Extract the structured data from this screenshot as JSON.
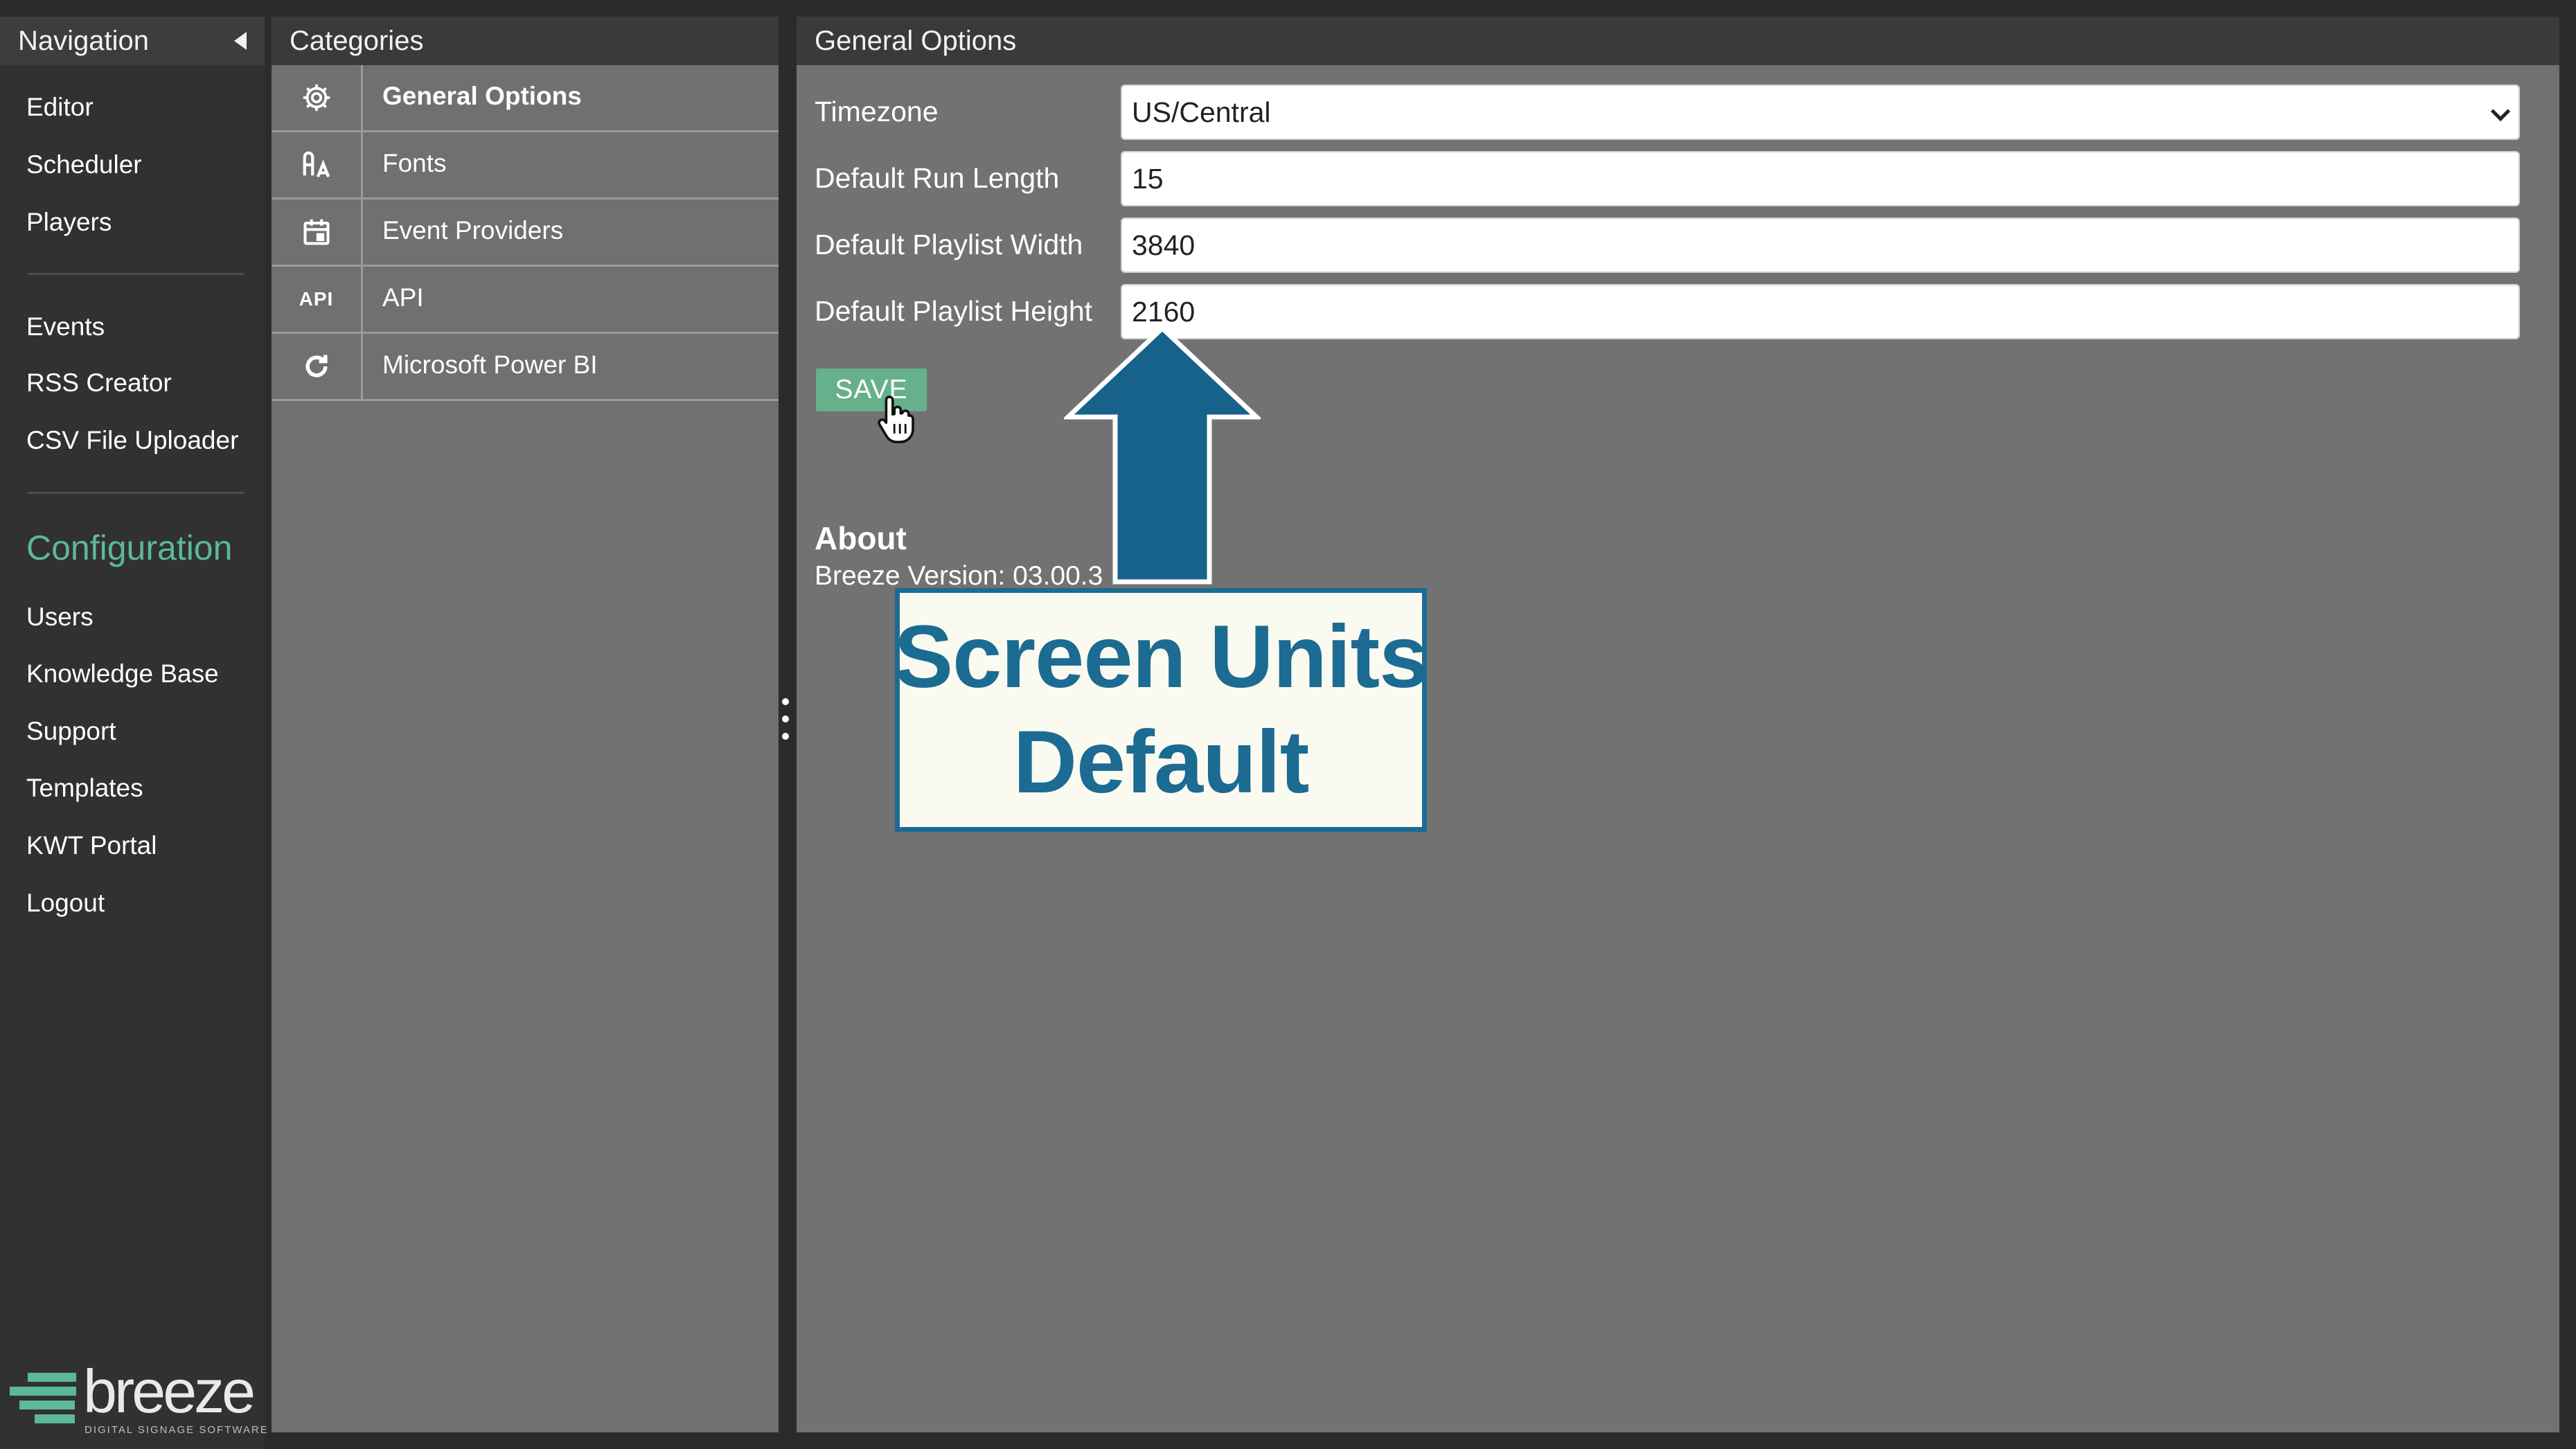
{
  "navigation": {
    "title": "Navigation",
    "items_top": [
      {
        "label": "Editor"
      },
      {
        "label": "Scheduler"
      },
      {
        "label": "Players"
      }
    ],
    "items_mid": [
      {
        "label": "Events"
      },
      {
        "label": "RSS Creator"
      },
      {
        "label": "CSV File Uploader"
      }
    ],
    "section_title": "Configuration",
    "items_config": [
      {
        "label": "Users"
      },
      {
        "label": "Knowledge Base"
      },
      {
        "label": "Support"
      },
      {
        "label": "Templates"
      },
      {
        "label": "KWT Portal"
      },
      {
        "label": "Logout"
      }
    ],
    "logo_word": "breeze",
    "logo_tagline": "DIGITAL SIGNAGE SOFTWARE"
  },
  "categories": {
    "title": "Categories",
    "items": [
      {
        "label": "General Options",
        "icon": "gear-icon",
        "selected": true
      },
      {
        "label": "Fonts",
        "icon": "font-icon",
        "selected": false
      },
      {
        "label": "Event Providers",
        "icon": "calendar-icon",
        "selected": false
      },
      {
        "label": "API",
        "icon": "api-icon",
        "icon_text": "API",
        "selected": false
      },
      {
        "label": "Microsoft Power BI",
        "icon": "refresh-icon",
        "selected": false
      }
    ]
  },
  "general_options": {
    "title": "General Options",
    "fields": [
      {
        "label": "Timezone",
        "value": "US/Central",
        "type": "select"
      },
      {
        "label": "Default Run Length",
        "value": "15",
        "type": "text"
      },
      {
        "label": "Default Playlist Width",
        "value": "3840",
        "type": "text"
      },
      {
        "label": "Default Playlist Height",
        "value": "2160",
        "type": "text"
      }
    ],
    "save_label": "SAVE",
    "about_title": "About",
    "about_version": "Breeze Version: 03.00.3"
  },
  "annotation": {
    "line1": "Screen Units",
    "line2": "Default",
    "color": "#1c6b92"
  },
  "colors": {
    "accent": "#5cb89a",
    "save_button": "#66b08c",
    "panel_bg": "#727272",
    "nav_bg": "#313131"
  }
}
